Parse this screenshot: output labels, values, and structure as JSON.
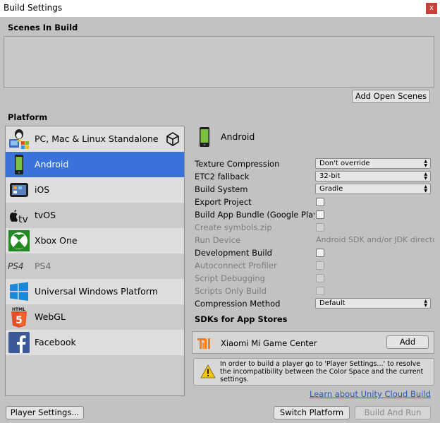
{
  "window": {
    "title": "Build Settings",
    "close_label": "x"
  },
  "scenes": {
    "label": "Scenes In Build",
    "add_open_scenes_label": "Add Open Scenes"
  },
  "platform": {
    "label": "Platform",
    "items": [
      {
        "label": "PC, Mac & Linux Standalone",
        "icon": "pc-mac-linux-icon"
      },
      {
        "label": "Android",
        "icon": "android-icon"
      },
      {
        "label": "iOS",
        "icon": "ios-icon"
      },
      {
        "label": "tvOS",
        "icon": "tvos-icon"
      },
      {
        "label": "Xbox One",
        "icon": "xbox-icon"
      },
      {
        "label": "PS4",
        "icon": "ps4-icon"
      },
      {
        "label": "Universal Windows Platform",
        "icon": "windows-icon"
      },
      {
        "label": "WebGL",
        "icon": "html5-icon"
      },
      {
        "label": "Facebook",
        "icon": "facebook-icon"
      }
    ],
    "selected": "Android"
  },
  "settings": {
    "header": "Android",
    "texture_compression": {
      "label": "Texture Compression",
      "value": "Don't override"
    },
    "etc2_fallback": {
      "label": "ETC2 fallback",
      "value": "32-bit"
    },
    "build_system": {
      "label": "Build System",
      "value": "Gradle"
    },
    "export_project": {
      "label": "Export Project"
    },
    "build_app_bundle": {
      "label": "Build App Bundle (Google Play)"
    },
    "create_symbols": {
      "label": "Create symbols.zip"
    },
    "run_device": {
      "label": "Run Device",
      "value": "Android SDK and/or JDK directory not set"
    },
    "development_build": {
      "label": "Development Build"
    },
    "autoconnect_profiler": {
      "label": "Autoconnect Profiler"
    },
    "script_debugging": {
      "label": "Script Debugging"
    },
    "scripts_only_build": {
      "label": "Scripts Only Build"
    },
    "compression_method": {
      "label": "Compression Method",
      "value": "Default"
    }
  },
  "sdks": {
    "label": "SDKs for App Stores",
    "item_name": "Xiaomi Mi Game Center",
    "add_label": "Add"
  },
  "warning": {
    "text": "In order to build a player go to 'Player Settings...' to resolve the incompatibility between the Color Space and the current settings."
  },
  "cloud_link": "Learn about Unity Cloud Build",
  "footer": {
    "player_settings_label": "Player Settings...",
    "switch_platform_label": "Switch Platform",
    "build_and_run_label": "Build And Run"
  },
  "colors": {
    "selection": "#3a72d9",
    "link": "#2a55b8",
    "close_button": "#c84138"
  }
}
